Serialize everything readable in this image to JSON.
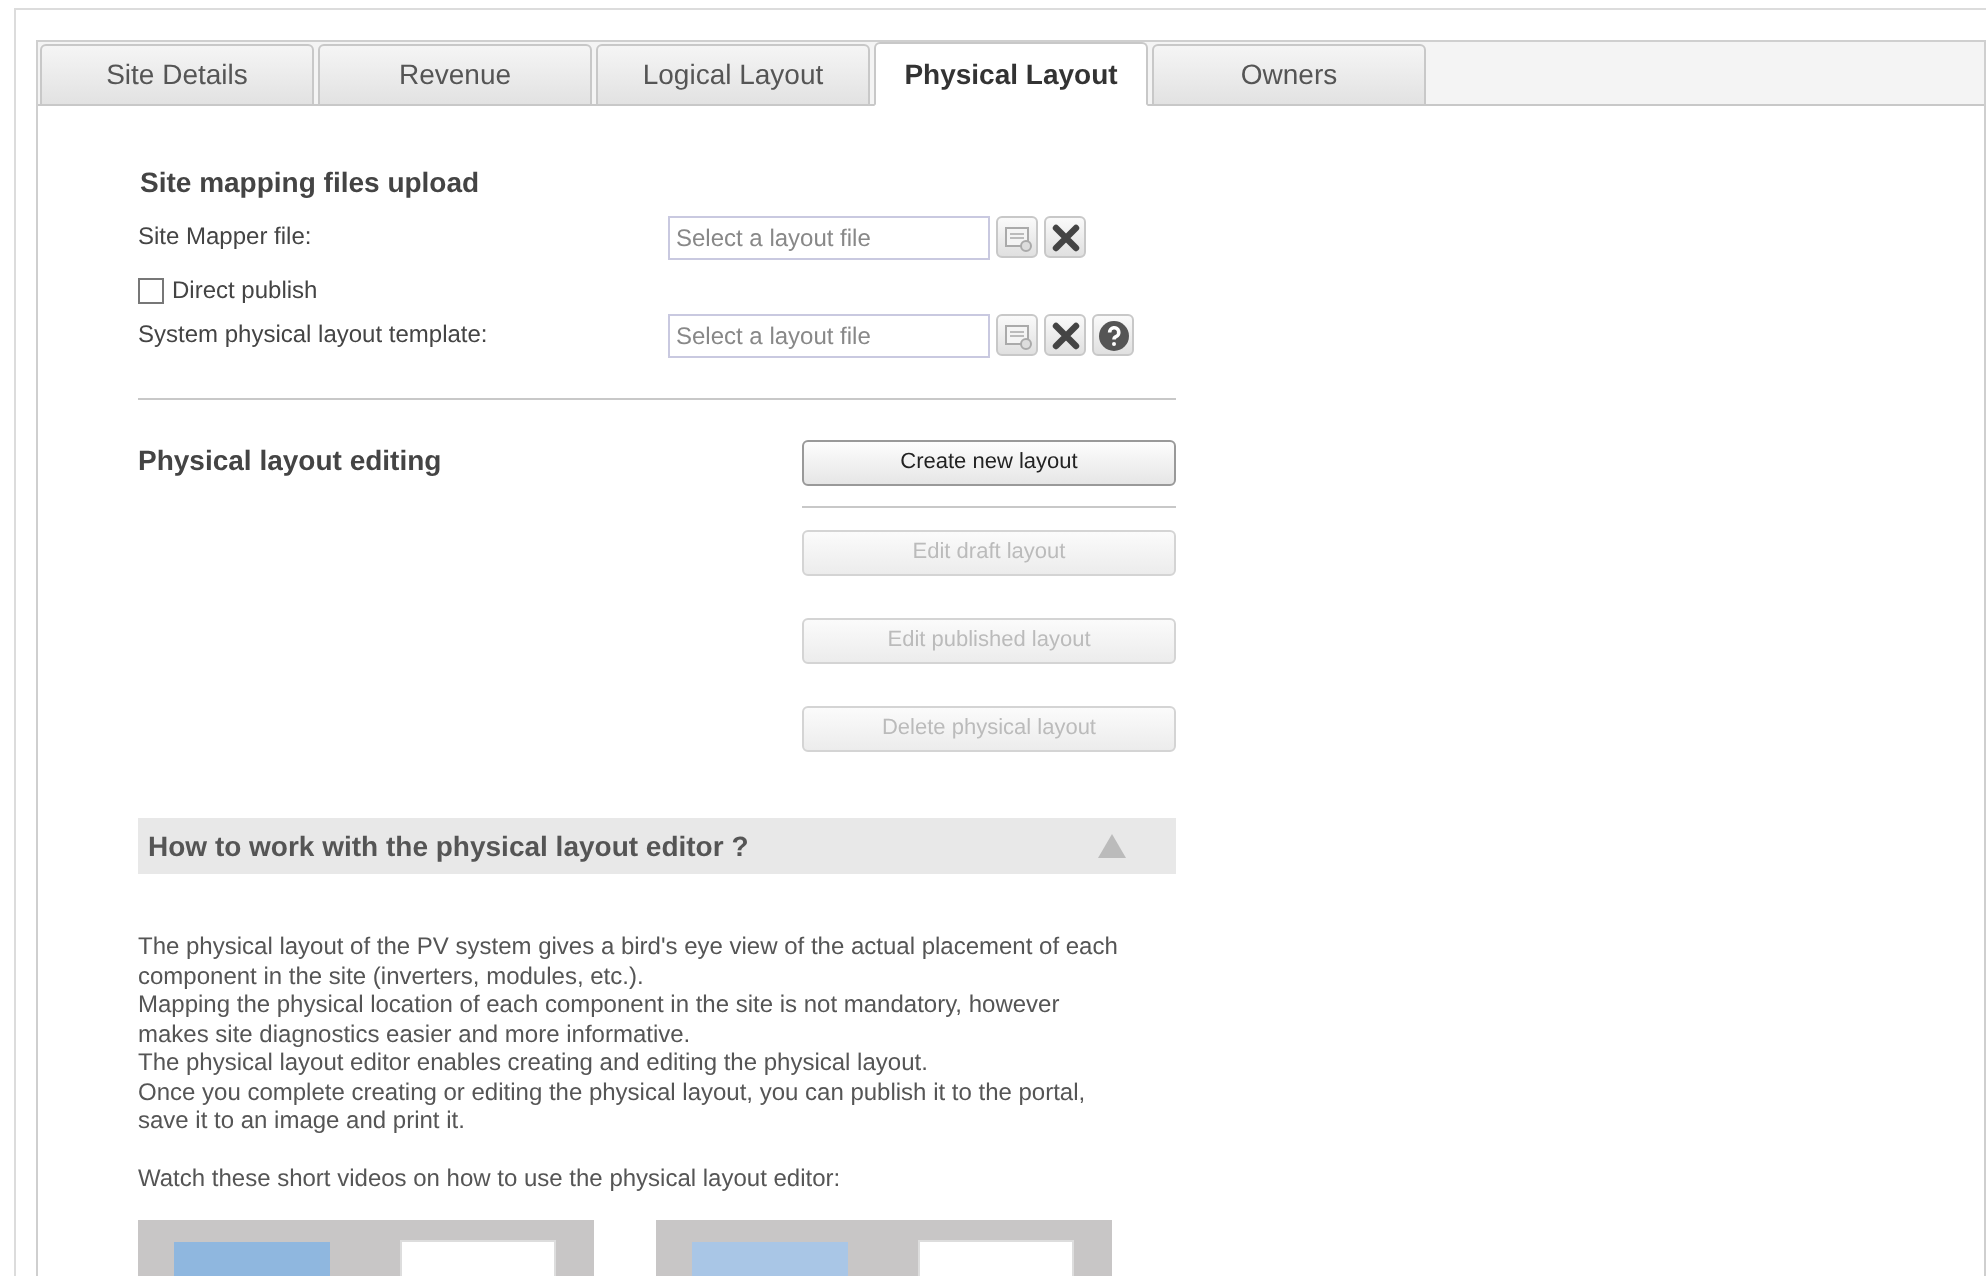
{
  "tabs": [
    {
      "label": "Site Details",
      "selected": false
    },
    {
      "label": "Revenue",
      "selected": false
    },
    {
      "label": "Logical Layout",
      "selected": false
    },
    {
      "label": "Physical Layout",
      "selected": true
    },
    {
      "label": "Owners",
      "selected": false
    }
  ],
  "upload": {
    "title": "Site mapping files upload",
    "rows": [
      {
        "kind": "file",
        "label": "Site Mapper file:",
        "placeholder": "Select a layout file",
        "help": false
      },
      {
        "kind": "checkbox",
        "label": "Direct publish",
        "checked": false
      },
      {
        "kind": "file",
        "label": "System physical layout template:",
        "placeholder": "Select a layout file",
        "help": true
      }
    ]
  },
  "editing": {
    "title": "Physical layout editing",
    "buttons": [
      {
        "label": "Create new layout",
        "disabled": false
      },
      {
        "label": "Edit draft layout",
        "disabled": true
      },
      {
        "label": "Edit published layout",
        "disabled": true
      },
      {
        "label": "Delete physical layout",
        "disabled": true
      }
    ]
  },
  "help": {
    "title": "How to work with the physical layout editor ?",
    "expanded": true,
    "paragraphs": [
      "The physical layout of the PV system gives a bird's eye view of the actual placement of each component in the site (inverters, modules, etc.).",
      "Mapping the physical location of each component in the site is not mandatory, however makes site diagnostics easier and more informative.",
      "The physical layout editor enables creating and editing the physical layout.",
      "Once you complete creating or editing the physical layout, you can publish it to the portal, save it to an image and print it."
    ],
    "videos_intro": "Watch these short videos on how to use the physical layout editor:",
    "videos": [
      {
        "kind": "video"
      },
      {
        "kind": "video"
      }
    ]
  }
}
